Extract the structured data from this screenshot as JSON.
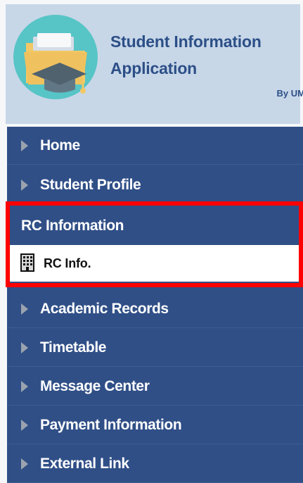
{
  "app": {
    "title_line_1": "Student Information",
    "title_line_2": "Application",
    "byline": "By UM"
  },
  "nav": {
    "items": [
      {
        "label": "Home",
        "icon": "right-triangle-icon"
      },
      {
        "label": "Student Profile",
        "icon": "right-triangle-icon"
      },
      {
        "label": "Academic Records",
        "icon": "right-triangle-icon"
      },
      {
        "label": "Timetable",
        "icon": "right-triangle-icon"
      },
      {
        "label": "Message Center",
        "icon": "right-triangle-icon"
      },
      {
        "label": "Payment Information",
        "icon": "right-triangle-icon"
      },
      {
        "label": "External Link",
        "icon": "right-triangle-icon"
      }
    ],
    "section": {
      "label": "RC Information",
      "submenu": {
        "label": "RC Info.",
        "icon": "building-icon"
      }
    }
  },
  "colors": {
    "header_bg": "#c7d7e8",
    "nav_bg": "#304f87",
    "title": "#2d4f87",
    "highlight": "#ff0000"
  }
}
